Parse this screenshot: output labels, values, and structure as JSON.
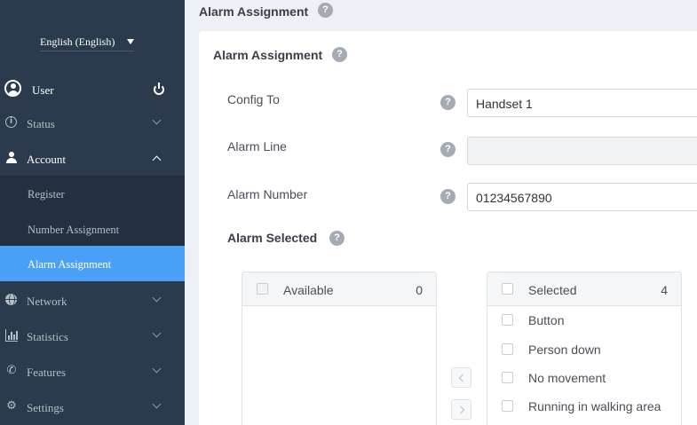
{
  "sidebar": {
    "language": "English (English)",
    "user_label": "User",
    "nav": {
      "status": "Status",
      "account": "Account",
      "account_sub": {
        "register": "Register",
        "number_assignment": "Number Assignment",
        "alarm_assignment": "Alarm Assignment"
      },
      "network": "Network",
      "statistics": "Statistics",
      "features": "Features",
      "settings": "Settings"
    },
    "active_item": "Alarm Assignment",
    "active_color": "#4aa0f4",
    "background_color": "#2b3a4c"
  },
  "header": {
    "title": "Alarm Assignment",
    "help_glyph": "?"
  },
  "card": {
    "title": "Alarm Assignment",
    "help_glyph": "?",
    "fields": {
      "config_to": {
        "label": "Config To",
        "value": "Handset 1"
      },
      "alarm_line": {
        "label": "Alarm Line",
        "value": ""
      },
      "alarm_number": {
        "label": "Alarm Number",
        "value": "01234567890"
      }
    },
    "alarm_selected": {
      "title": "Alarm Selected",
      "available": {
        "title": "Available",
        "count": "0",
        "items": []
      },
      "selected": {
        "title": "Selected",
        "count": "4",
        "items": [
          "Button",
          "Person down",
          "No movement",
          "Running in walking area"
        ]
      }
    }
  }
}
